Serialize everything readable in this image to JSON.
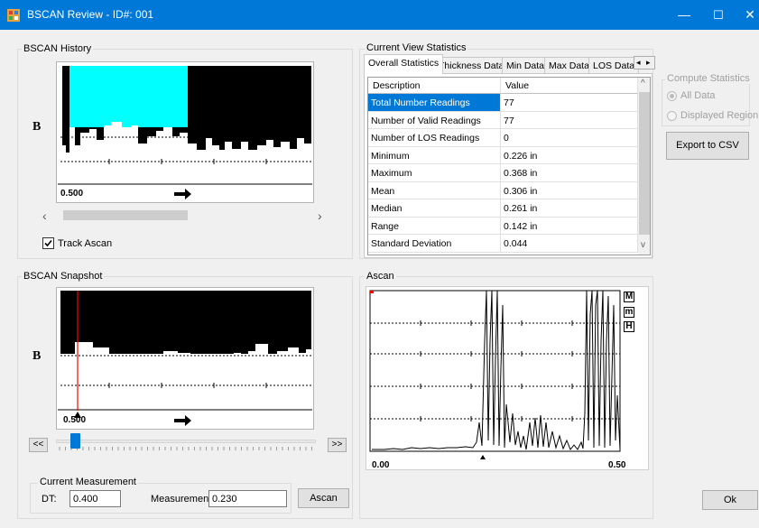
{
  "window": {
    "title": "BSCAN Review - ID#: 001",
    "controls": {
      "minimize": "—",
      "maximize": "☐",
      "close": "✕"
    }
  },
  "history": {
    "group_label": "BSCAN History",
    "b_label": "B",
    "scale_label": "0.500",
    "scroll_left": "‹",
    "scroll_right": "›",
    "track_ascan_label": "Track Ascan",
    "track_ascan_checked": true,
    "scroll_position": 0.38
  },
  "stats": {
    "group_label": "Current View Statistics",
    "tabs": [
      "Overall Statistics",
      "Thickness Data",
      "Min Data",
      "Max Data",
      "LOS Data"
    ],
    "active_tab": 0,
    "columns": [
      "Description",
      "Value"
    ],
    "rows": [
      {
        "desc": "Total Number Readings",
        "value": "77"
      },
      {
        "desc": "Number of Valid Readings",
        "value": "77"
      },
      {
        "desc": "Number of LOS Readings",
        "value": "0"
      },
      {
        "desc": "Minimum",
        "value": "0.226 in"
      },
      {
        "desc": "Maximum",
        "value": "0.368 in"
      },
      {
        "desc": "Mean",
        "value": "0.306 in"
      },
      {
        "desc": "Median",
        "value": "0.261 in"
      },
      {
        "desc": "Range",
        "value": "0.142 in"
      },
      {
        "desc": "Standard Deviation",
        "value": "0.044"
      }
    ],
    "scroll_up": "^",
    "scroll_down": "v",
    "tab_left": "◂",
    "tab_right": "▸"
  },
  "compute": {
    "group_label": "Compute Statistics",
    "options": [
      "All Data",
      "Displayed Region"
    ],
    "selected": 0,
    "export_label": "Export to CSV"
  },
  "snapshot": {
    "group_label": "BSCAN Snapshot",
    "b_label": "B",
    "scale_label": "0.500",
    "prev_label": "<<",
    "next_label": ">>",
    "cursor_fraction": 0.07
  },
  "measurement": {
    "group_label": "Current Measurement",
    "dt_label": "DT:",
    "dt_value": "0.400",
    "measurement_label": "Measurement:",
    "measurement_value": "0.230",
    "ascan_label": "Ascan"
  },
  "ascan": {
    "group_label": "Ascan",
    "x_min": "0.00",
    "x_max": "0.50",
    "side_buttons": [
      "M",
      "m",
      "H"
    ]
  },
  "ok_label": "Ok",
  "colors": {
    "titlebar": "#0078d7",
    "history_highlight": "#00ffff",
    "selection": "#0078d7",
    "cursor": "#ff0000"
  }
}
